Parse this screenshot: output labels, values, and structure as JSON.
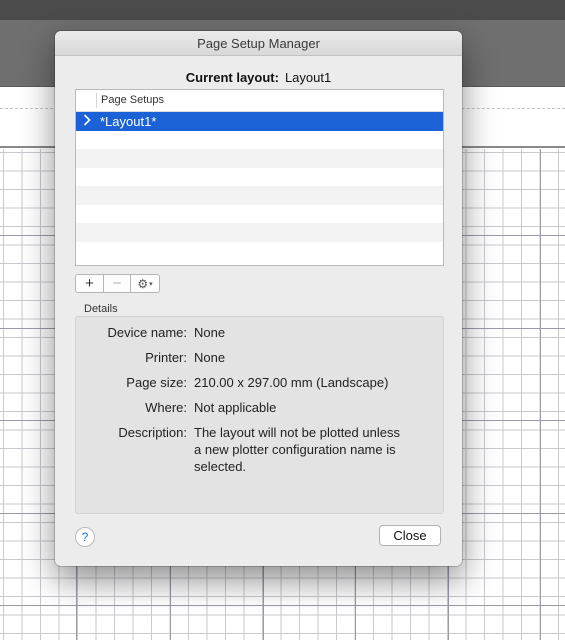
{
  "dialog": {
    "title": "Page Setup Manager",
    "current_layout_label": "Current layout:",
    "current_layout_value": "Layout1"
  },
  "page_setups": {
    "column_header": "Page Setups",
    "items": [
      {
        "label": "*Layout1*",
        "selected": true,
        "expand_icon": "chevron-right-icon"
      }
    ]
  },
  "toolbar": {
    "add_symbol": "+",
    "remove_symbol": "−",
    "gear_symbol": "⚙",
    "gear_caret": "▾"
  },
  "details": {
    "section_label": "Details",
    "device_name_label": "Device name:",
    "device_name_value": "None",
    "printer_label": "Printer:",
    "printer_value": "None",
    "page_size_label": "Page size:",
    "page_size_value": "210.00 x 297.00 mm (Landscape)",
    "where_label": "Where:",
    "where_value": "Not applicable",
    "description_label": "Description:",
    "description_line1": "The layout will not be plotted unless",
    "description_line2": "a new plotter configuration name is",
    "description_line3": "selected."
  },
  "footer": {
    "help_symbol": "?",
    "close_label": "Close"
  },
  "colors": {
    "selection": "#1a62d6",
    "dialog_background": "#ececec"
  }
}
